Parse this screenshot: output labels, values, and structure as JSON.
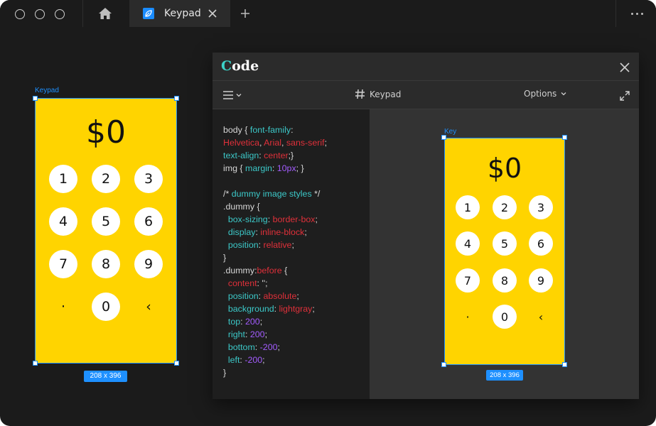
{
  "titlebar": {
    "tab_label": "Keypad",
    "icons": [
      "window-control-circle",
      "home-icon",
      "leaf-icon",
      "close-icon",
      "plus-icon",
      "more-dots-icon"
    ]
  },
  "canvas_frame": {
    "label": "Keypad",
    "size_badge": "208 x 396",
    "amount": "$0",
    "keys": [
      "1",
      "2",
      "3",
      "4",
      "5",
      "6",
      "7",
      "8",
      "9",
      "·",
      "0",
      "‹"
    ],
    "fill_color": "#ffd400",
    "selection_color": "#1e90ff"
  },
  "code_panel": {
    "title_first": "C",
    "title_rest": "ode",
    "toolbar_title": "Keypad",
    "options_label": "Options",
    "icons": [
      "close-icon",
      "hamburger-menu-icon",
      "chevron-down-icon",
      "hash-icon",
      "expand-icon"
    ],
    "code_lines": [
      "body { font-family:",
      "Helvetica, Arial, sans-serif;",
      "text-align: center;}",
      "img { margin: 10px; }",
      "",
      "/* dummy image styles */",
      ".dummy {",
      "  box-sizing: border-box;",
      "  display: inline-block;",
      "  position: relative;",
      "}",
      ".dummy:before {",
      "  content: '';",
      "  position: absolute;",
      "  background: lightgray;",
      "  top: 200;",
      "  right: 200;",
      "  bottom: -200;",
      "  left: -200;",
      "}"
    ],
    "preview": {
      "label": "Key",
      "size_badge": "208 x 396",
      "amount": "$0",
      "keys": [
        "1",
        "2",
        "3",
        "4",
        "5",
        "6",
        "7",
        "8",
        "9",
        "·",
        "0",
        "‹"
      ]
    }
  }
}
